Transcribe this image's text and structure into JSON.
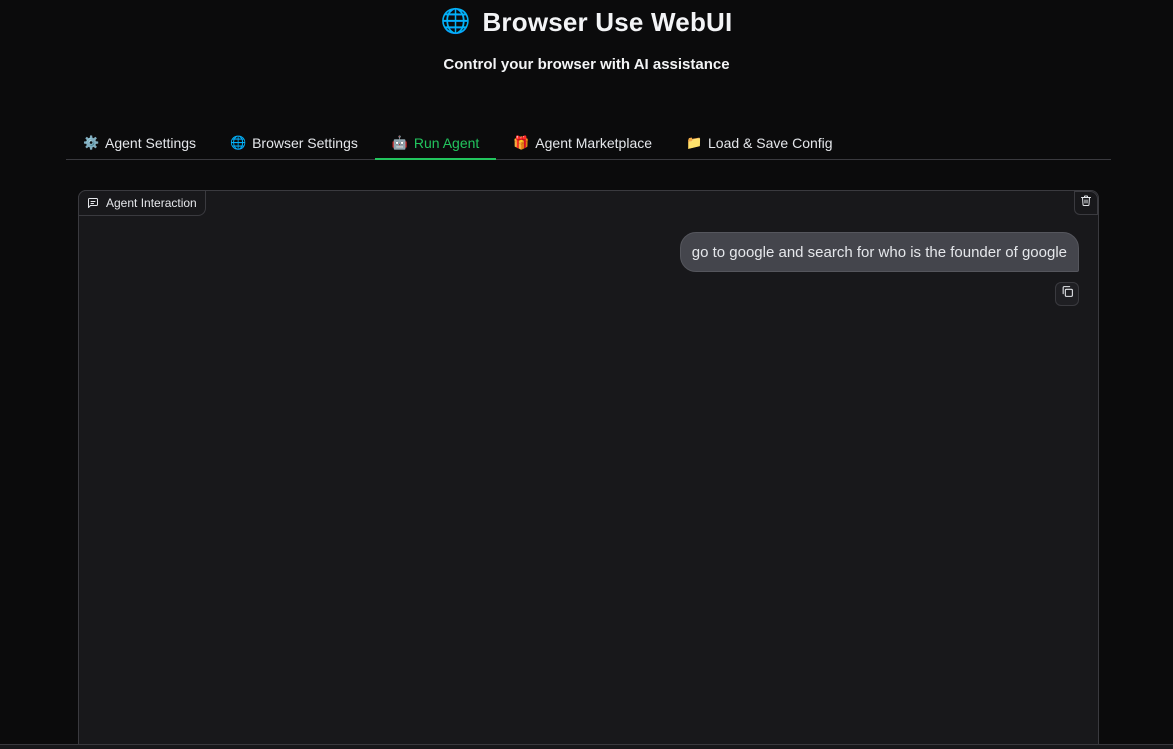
{
  "header": {
    "icon": "globe-icon",
    "icon_glyph": "🌐",
    "title": "Browser Use WebUI",
    "subtitle": "Control your browser with AI assistance"
  },
  "tabs": [
    {
      "label": "Agent Settings",
      "icon": "gear-icon",
      "glyph": "⚙️",
      "active": false
    },
    {
      "label": "Browser Settings",
      "icon": "globe-icon",
      "glyph": "🌐",
      "active": false
    },
    {
      "label": "Run Agent",
      "icon": "robot-icon",
      "glyph": "🤖",
      "active": true
    },
    {
      "label": "Agent Marketplace",
      "icon": "gift-icon",
      "glyph": "🎁",
      "active": false
    },
    {
      "label": "Load & Save Config",
      "icon": "folder-icon",
      "glyph": "📁",
      "active": false
    }
  ],
  "chat": {
    "label": "Agent Interaction",
    "messages": [
      {
        "role": "user",
        "text": "go to google and search for who is the founder of google"
      }
    ]
  },
  "colors": {
    "background": "#0b0b0c",
    "panel": "#18181b",
    "accent": "#22c55e",
    "border": "#3a3a3f",
    "bubble": "#44454c"
  }
}
